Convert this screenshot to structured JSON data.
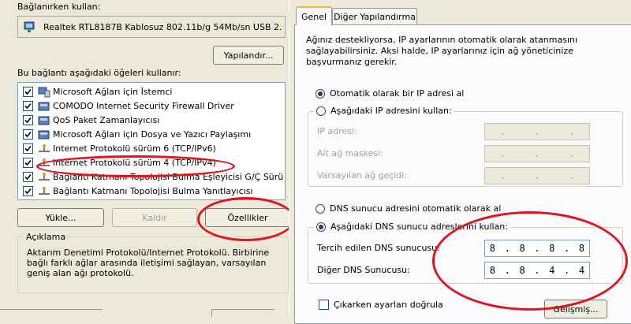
{
  "left_panel": {
    "connect_using_label": "Bağlanırken kullan:",
    "adapter_name": "Realtek RTL8187B Kablosuz 802.11b/g 54Mb/sn USB 2.",
    "configure_button": "Yapılandır...",
    "components_label": "Bu bağlantı aşağıdaki öğeleri kullanır:",
    "items": [
      {
        "label": "Microsoft Ağları için İstemci",
        "checked": true,
        "icon": "network-client-icon"
      },
      {
        "label": "COMODO Internet Security Firewall Driver",
        "checked": true,
        "icon": "network-service-icon"
      },
      {
        "label": "QoS Paket Zamanlayıcısı",
        "checked": true,
        "icon": "network-service-icon"
      },
      {
        "label": "Microsoft Ağları için Dosya ve Yazıcı Paylaşımı",
        "checked": true,
        "icon": "network-service-icon"
      },
      {
        "label": "Internet Protokolü sürüm 6 (TCP/IPv6)",
        "checked": true,
        "icon": "protocol-icon"
      },
      {
        "label": "Internet Protokolü sürüm 4 (TCP/IPv4)",
        "checked": true,
        "icon": "protocol-icon"
      },
      {
        "label": "Bağlantı Katmanı Topolojisi Bulma Eşleyicisi G/Ç Sürücü..",
        "checked": true,
        "icon": "protocol-icon"
      },
      {
        "label": "Bağlantı Katmanı Topolojisi Bulma Yanıtlayıcısı",
        "checked": true,
        "icon": "protocol-icon"
      }
    ],
    "install_button": "Yükle...",
    "uninstall_button": "Kaldır",
    "properties_button": "Özellikler",
    "description_label": "Açıklama",
    "description_text": "Aktarım Denetimi Protokolü/Internet Protokolü. Birbirine bağlı farklı ağlar arasında iletişimi sağlayan, varsayılan geniş alan ağı protokolü."
  },
  "right_panel": {
    "tabs": [
      {
        "label": "Genel",
        "active": true
      },
      {
        "label": "Diğer Yapılandırma",
        "active": false
      }
    ],
    "intro_text": "Ağınız destekliyorsa, IP ayarlarının otomatik olarak atanmasını sağlayabilirsiniz. Aksi halde, IP ayarlarınız için ağ yöneticinize başvurmanız gerekir.",
    "auto_ip_label": "Otomatik olarak bir IP adresi al",
    "manual_ip_label": "Aşağıdaki IP adresini kullan:",
    "ip_address_label": "IP adresi:",
    "subnet_label": "Alt ağ maskesi:",
    "gateway_label": "Varsayılan ağ geçidi:",
    "auto_dns_label": "DNS sunucu adresini otomatik olarak al",
    "manual_dns_label": "Aşağıdaki DNS sunucu adreslerini kullan:",
    "preferred_dns_label": "Tercih edilen DNS sunucusu:",
    "preferred_dns_octets": [
      "8",
      "8",
      "8",
      "8"
    ],
    "alternate_dns_label": "Diğer DNS Sunucusu:",
    "alternate_dns_octets": [
      "8",
      "8",
      "4",
      "4"
    ],
    "validate_label": "Çıkarken ayarları doğrula",
    "advanced_button": "Gelişmiş..."
  },
  "colors": {
    "dialog_bg": "#ece9d8",
    "annotation_red": "#e0141f",
    "selection_blue": "#316ac5"
  }
}
